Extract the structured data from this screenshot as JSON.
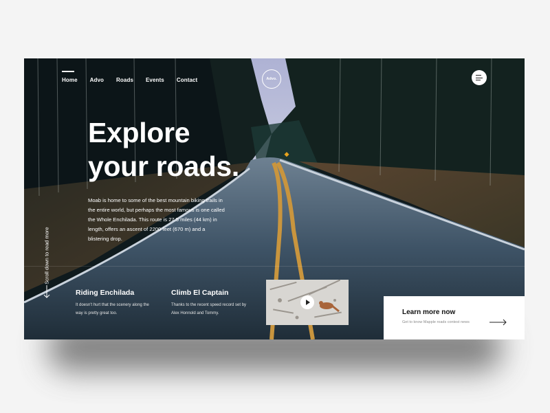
{
  "nav": {
    "items": [
      {
        "label": "Home",
        "active": true
      },
      {
        "label": "Advo",
        "active": false
      },
      {
        "label": "Roads",
        "active": false
      },
      {
        "label": "Events",
        "active": false
      },
      {
        "label": "Contact",
        "active": false
      }
    ]
  },
  "logo": {
    "text": "Advo."
  },
  "menu": {
    "icon": "hamburger-menu-icon"
  },
  "hero": {
    "headline_line1": "Explore",
    "headline_line2": "your roads.",
    "intro": "Moab is home to some of the best mountain biking trails in the entire world, but perhaps the most famous is one called the Whole Enchilada. This route is 27.5 miles (44 km) in length, offers an ascent of 2200 feet (670 m) and a blistering drop."
  },
  "scroll_hint": {
    "text": "Scroll down to read more",
    "icon": "arrow-down-icon"
  },
  "features": [
    {
      "title": "Riding  Enchilada",
      "text": "It doesn't hurt that the scenery along the way is pretty great too."
    },
    {
      "title": "Climb El Captain",
      "text": "Thanks to the recent speed record set by Alex Honnold and Tommy."
    }
  ],
  "video": {
    "icon": "play-icon"
  },
  "cta": {
    "title": "Learn more now",
    "subtitle": "Get to know Mapple roads contest news",
    "icon": "arrow-right-icon"
  },
  "colors": {
    "background": "#f4f4f4",
    "text_on_hero": "#ffffff",
    "road_line": "#c9953e",
    "sky": "#b8bcd8"
  }
}
